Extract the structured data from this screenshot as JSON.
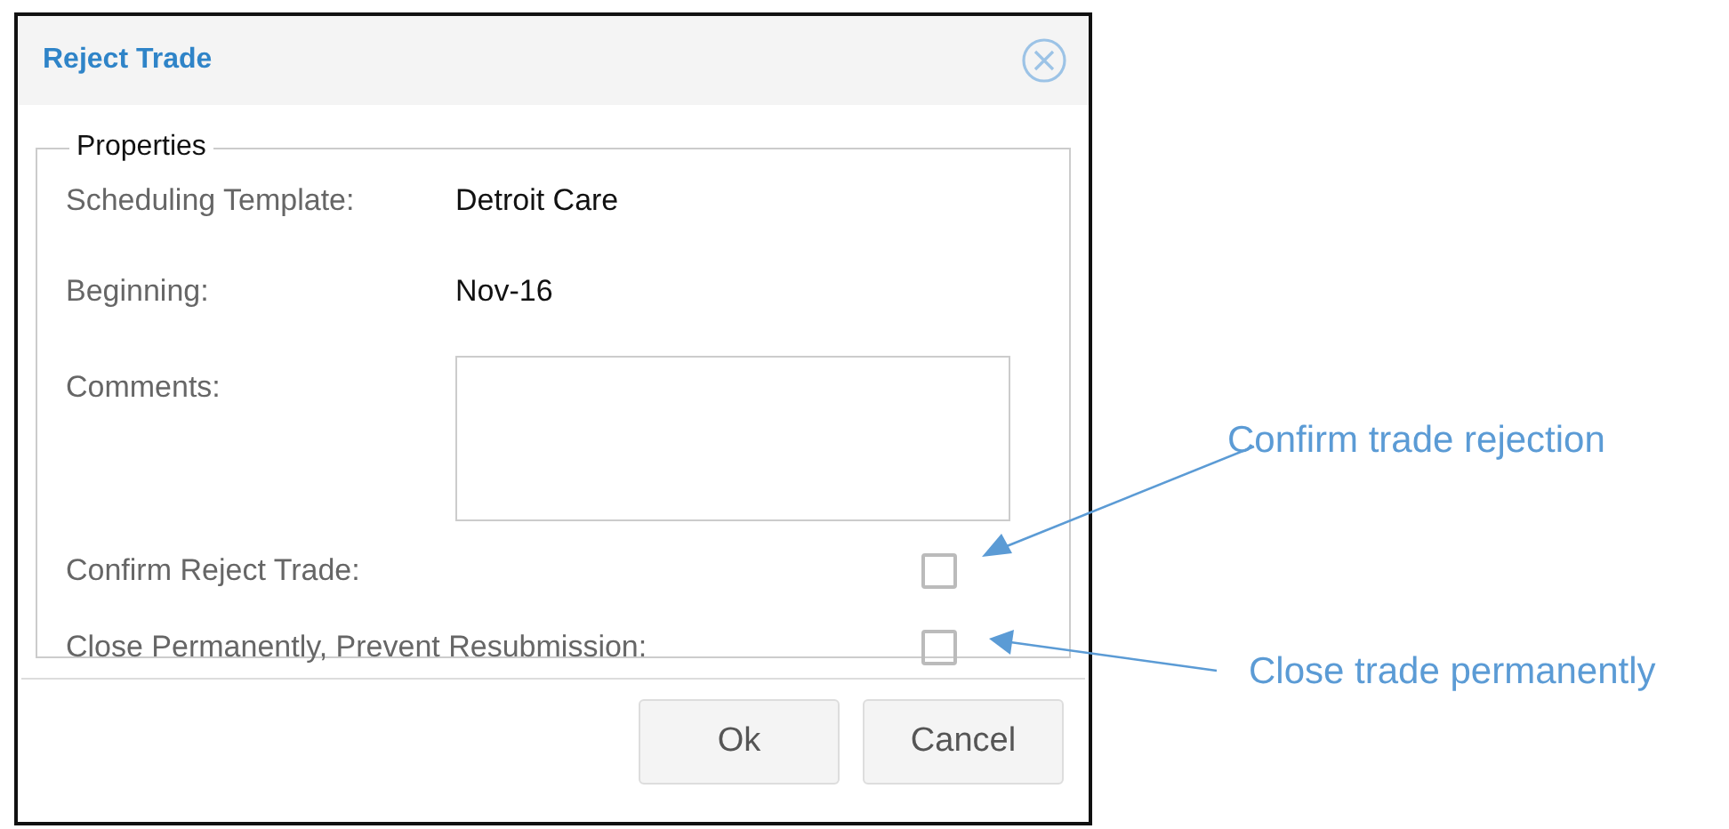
{
  "dialog": {
    "title": "Reject Trade",
    "section": "Properties",
    "fields": [
      {
        "kind": "text",
        "label": "Scheduling Template:",
        "value": "Detroit Care"
      },
      {
        "kind": "text",
        "label": "Beginning:",
        "value": "Nov-16"
      },
      {
        "kind": "textarea",
        "label": "Comments:"
      },
      {
        "kind": "checkbox",
        "label": "Confirm Reject Trade:",
        "checked": false
      },
      {
        "kind": "checkbox",
        "label": "Close Permanently, Prevent Resubmission:",
        "checked": false
      }
    ],
    "buttons": [
      "Ok",
      "Cancel"
    ]
  },
  "annotations": [
    "Confirm trade rejection",
    "Close trade permanently"
  ]
}
